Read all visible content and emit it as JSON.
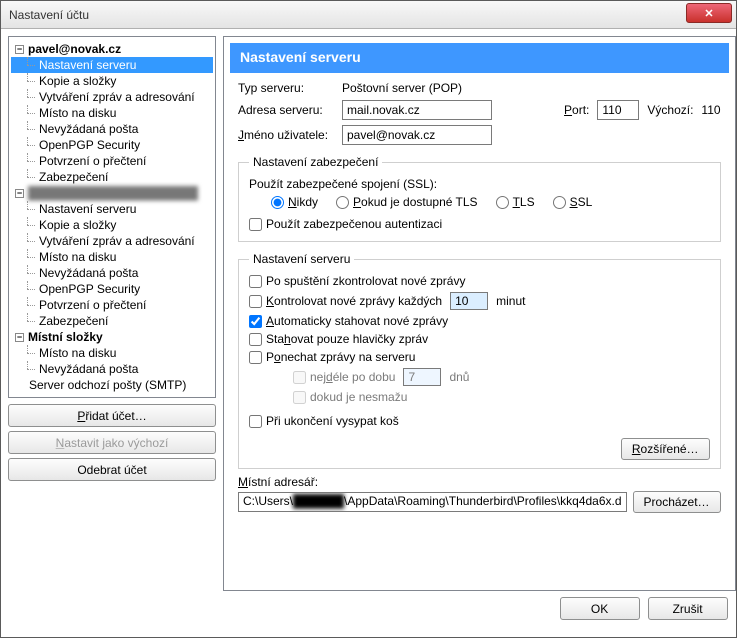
{
  "window": {
    "title": "Nastavení účtu"
  },
  "tree": {
    "acc1": {
      "name": "pavel@novak.cz",
      "items": [
        "Nastavení serveru",
        "Kopie a složky",
        "Vytváření zpráv a adresování",
        "Místo na disku",
        "Nevyžádaná pošta",
        "OpenPGP Security",
        "Potvrzení o přečtení",
        "Zabezpečení"
      ]
    },
    "acc2": {
      "name": "████████████████████",
      "items": [
        "Nastavení serveru",
        "Kopie a složky",
        "Vytváření zpráv a adresování",
        "Místo na disku",
        "Nevyžádaná pošta",
        "OpenPGP Security",
        "Potvrzení o přečtení",
        "Zabezpečení"
      ]
    },
    "local": {
      "name": "Místní složky",
      "items": [
        "Místo na disku",
        "Nevyžádaná pošta"
      ]
    },
    "smtp": "Server odchozí pošty (SMTP)"
  },
  "sidebuttons": {
    "add": "Přidat účet…",
    "default": "Nastavit jako výchozí",
    "remove": "Odebrat účet"
  },
  "panel": {
    "title": "Nastavení serveru",
    "labels": {
      "type": "Typ serveru:",
      "typeValue": "Poštovní server (POP)",
      "address": "Adresa serveru:",
      "port": "Port:",
      "defaultPort": "Výchozí:",
      "defaultPortValue": "110",
      "user": "Jméno uživatele:"
    },
    "values": {
      "address": "mail.novak.cz",
      "port": "110",
      "user": "pavel@novak.cz"
    },
    "security": {
      "legend": "Nastavení zabezpečení",
      "sslLabel": "Použít zabezpečené spojení (SSL):",
      "opts": {
        "never": "Nikdy",
        "tlsAvail": "Pokud je dostupné TLS",
        "tls": "TLS",
        "ssl": "SSL"
      },
      "secureAuth": "Použít zabezpečenou autentizaci"
    },
    "server": {
      "legend": "Nastavení serveru",
      "checkOnStart": "Po spuštění zkontrolovat nové zprávy",
      "checkEvery_pre": "Kontrolovat nové zprávy každých",
      "checkEvery_val": "10",
      "checkEvery_post": "minut",
      "autoDownload": "Automaticky stahovat nové zprávy",
      "headersOnly": "Stahovat pouze hlavičky zpráv",
      "leaveOnServer": "Ponechat zprávy na serveru",
      "maxDays_pre": "nejdéle po dobu",
      "maxDays_val": "7",
      "maxDays_post": "dnů",
      "untilDelete": "dokud je nesmažu",
      "emptyTrash": "Při ukončení vysypat koš",
      "advanced": "Rozšířené…"
    },
    "localdir": {
      "label": "Místní adresář:",
      "value_pre": "C:\\Users\\",
      "value_blur": "██████",
      "value_post": "\\AppData\\Roaming\\Thunderbird\\Profiles\\kkq4da6x.d",
      "browse": "Procházet…"
    }
  },
  "footer": {
    "ok": "OK",
    "cancel": "Zrušit"
  }
}
